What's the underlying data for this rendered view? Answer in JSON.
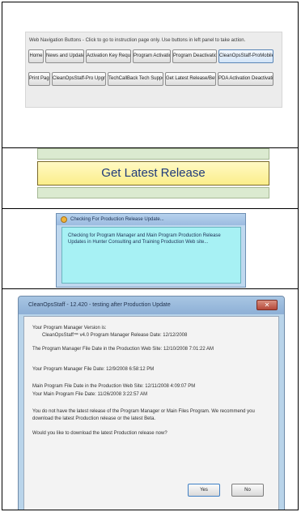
{
  "panel1": {
    "caption": "Web Navigation Buttons - Click to go to instruction page only. Use buttons in left panel to take action.",
    "row1": [
      "Home",
      "News and Updates",
      "Activation Key Request",
      "Program Activation",
      "Program Deactivation",
      "CleanOpsStaff-ProMobile"
    ],
    "row2": [
      "Print Page",
      "CleanOpsStaff-Pro Upgrades",
      "TechCallBack Tech Support",
      "Get Latest Release/Beta",
      "PDA Activation Deactivation"
    ]
  },
  "panel2": {
    "button_label": "Get Latest Release"
  },
  "panel3": {
    "title": "Checking For Production Release Update...",
    "message": "Checking for Program Manager and Main Program Production Release Updates in Hunter Consulting and Training Production Web site..."
  },
  "panel4": {
    "title": "CleanOpsStaff - 12.420 - testing after Production Update",
    "msg1": "Your Program Manager Version is:",
    "msg2": "CleanOpsStaff™ v4.0 Program Manager Release Date: 12/12/2008",
    "msg3": "The Program Manager File Date in the Production Web Site: 12/10/2008 7:01:22 AM",
    "msg4": "Your Program Manager File Date: 12/9/2008 6:58:12 PM",
    "msg5": "Main Program File Date in the Production Web Site: 12/11/2008 4:09:07 PM",
    "msg6": "Your Main Program File Date: 11/26/2008 3:22:57 AM",
    "msg7": "You do not have the latest release of the Program Manager or Main Files Program. We recommend you download the latest Production release or the latest Beta.",
    "msg8": "Would you like to download the latest Production release now?",
    "yes_label": "Yes",
    "no_label": "No"
  }
}
